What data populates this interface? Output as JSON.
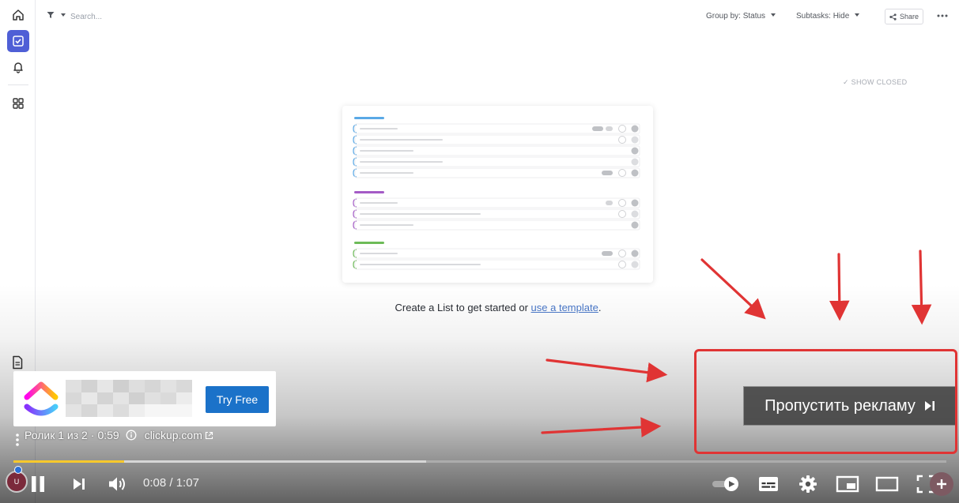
{
  "app": {
    "search": {
      "placeholder": "Search..."
    },
    "group_by": {
      "label": "Group by:",
      "value": "Status"
    },
    "subtasks": {
      "label": "Subtasks:",
      "value": "Hide"
    },
    "share_label": "Share",
    "show_closed": "SHOW CLOSED",
    "empty_state": {
      "text": "Create a List to get started or",
      "link": "use a template",
      "suffix": "."
    },
    "rail_icons": [
      "home-icon",
      "tasks-icon",
      "bell-icon",
      "dashboards-icon",
      "doc-icon"
    ],
    "colors": {
      "accent": "#4f5fd6",
      "link": "#4a78c9"
    }
  },
  "video": {
    "ad": {
      "cta_label": "Try Free",
      "position": "Ролик 1 из 2",
      "separator": "·",
      "duration": "0:59",
      "domain": "clickup.com"
    },
    "skip_label": "Пропустить рекламу",
    "time": {
      "current": "0:08",
      "total": "1:07"
    },
    "progress": {
      "played_fraction": 0.119,
      "buffered_fraction": 0.442
    },
    "avatar_initial": "U",
    "colors": {
      "progress": "#f7c92c",
      "cta": "#1b72c9",
      "annotation": "#e03434"
    }
  }
}
